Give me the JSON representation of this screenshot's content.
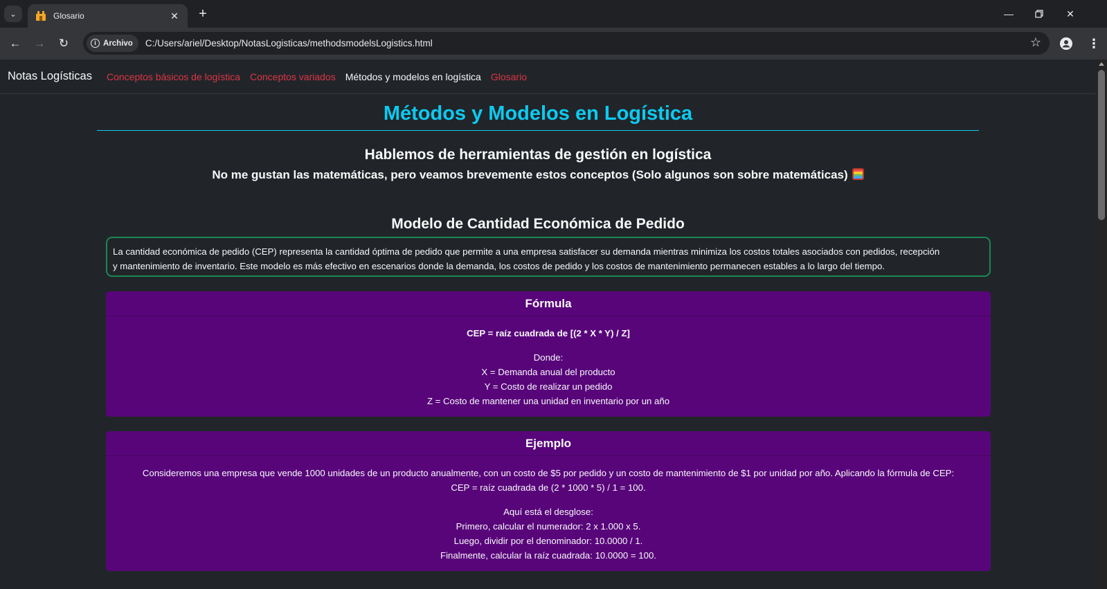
{
  "browser": {
    "tab_title": "Glosario",
    "chip_label": "Archivo",
    "url": "C:/Users/ariel/Desktop/NotasLogisticas/methodsmodelsLogistics.html"
  },
  "navbar": {
    "brand": "Notas Logísticas",
    "links": [
      {
        "label": "Conceptos básicos de logística",
        "active": false
      },
      {
        "label": "Conceptos variados",
        "active": false
      },
      {
        "label": "Métodos y modelos en logística",
        "active": true
      },
      {
        "label": "Glosario",
        "active": false
      }
    ]
  },
  "page": {
    "title": "Métodos y Modelos en Logística",
    "subtitle": "Hablemos de herramientas de gestión en logística",
    "lead": "No me gustan las matemáticas, pero veamos brevemente estos conceptos (Solo algunos son sobre matemáticas)",
    "section_title": "Modelo de Cantidad Económica de Pedido",
    "definition_line1": "La cantidad económica de pedido (CEP) representa la cantidad óptima de pedido que permite a una empresa satisfacer su demanda mientras minimiza los costos totales asociados con pedidos, recepción",
    "definition_line2": "y mantenimiento de inventario. Este modelo es más efectivo en escenarios donde la demanda, los costos de pedido y los costos de mantenimiento permanecen estables a lo largo del tiempo.",
    "formula_card": {
      "header": "Fórmula",
      "formula": "CEP = raíz cuadrada de [(2 * X * Y) / Z]",
      "where": "Donde:",
      "x_def": "X = Demanda anual del producto",
      "y_def": "Y = Costo de realizar un pedido",
      "z_def": "Z = Costo de mantener una unidad en inventario por un año"
    },
    "example_card": {
      "header": "Ejemplo",
      "line1": "Consideremos una empresa que vende 1000 unidades de un producto anualmente, con un costo de $5 por pedido y un costo de mantenimiento de $1 por unidad por año. Aplicando la fórmula de CEP:",
      "line2": "CEP = raíz cuadrada de (2 * 1000 * 5) / 1 = 100.",
      "breakdown_title": "Aquí está el desglose:",
      "step1": "Primero, calcular el numerador: 2 x 1.000 x 5.",
      "step2": "Luego, dividir por el denominador: 10.0000 / 1.",
      "step3": "Finalmente, calcular la raíz cuadrada: 10.0000 = 100."
    }
  }
}
